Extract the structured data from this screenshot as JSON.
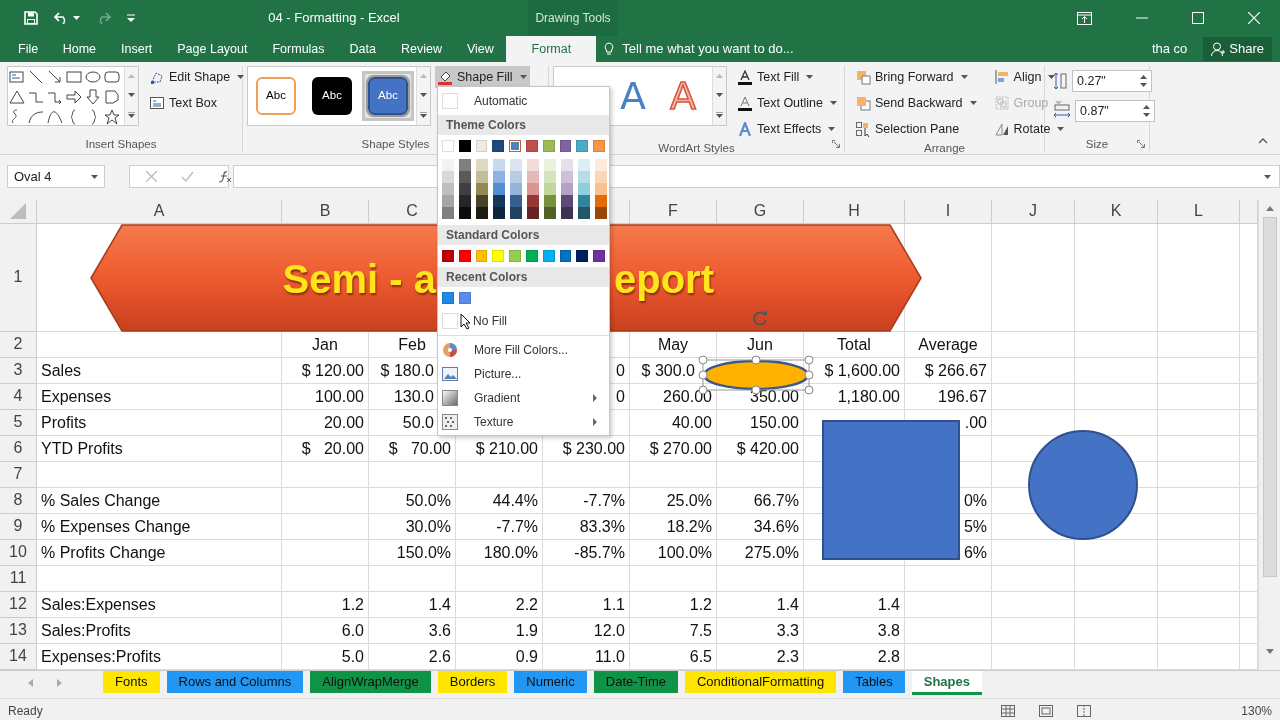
{
  "window": {
    "title": "04 - Formatting - Excel",
    "context_group": "Drawing Tools"
  },
  "ribbon_tabs": [
    {
      "label": "File",
      "selected": false
    },
    {
      "label": "Home",
      "selected": false
    },
    {
      "label": "Insert",
      "selected": false
    },
    {
      "label": "Page Layout",
      "selected": false
    },
    {
      "label": "Formulas",
      "selected": false
    },
    {
      "label": "Data",
      "selected": false
    },
    {
      "label": "Review",
      "selected": false
    },
    {
      "label": "View",
      "selected": false
    },
    {
      "label": "Format",
      "selected": true
    }
  ],
  "tell_me": "Tell me what you want to do...",
  "user": "tha co",
  "share": "Share",
  "ribbon": {
    "groups": [
      {
        "label": "Insert Shapes",
        "kind": "insert_shapes",
        "commands": [
          {
            "label": "Edit Shape",
            "kind": "edit_shape",
            "dropdown": true
          },
          {
            "label": "Text Box",
            "kind": "text_box"
          }
        ]
      },
      {
        "label": "Shape Styles",
        "kind": "shape_styles",
        "styles": [
          {
            "text": "Abc",
            "kind": "outline",
            "selected": false
          },
          {
            "text": "Abc",
            "kind": "dark",
            "selected": false
          },
          {
            "text": "Abc",
            "kind": "blue",
            "selected": true
          }
        ],
        "commands": [
          {
            "label": "Shape Fill",
            "kind": "shape_fill",
            "dropdown": true,
            "open": true
          }
        ]
      },
      {
        "label": "WordArt Styles",
        "kind": "wordart",
        "launcher": true,
        "styles": [
          {
            "text": "A",
            "kind": "fill"
          },
          {
            "text": "A",
            "kind": "outline"
          }
        ],
        "commands": [
          {
            "label": "Text Fill",
            "kind": "text_fill",
            "dropdown": true
          },
          {
            "label": "Text Outline",
            "kind": "text_outline",
            "dropdown": true
          },
          {
            "label": "Text Effects",
            "kind": "text_effects",
            "dropdown": true
          }
        ]
      },
      {
        "label": "Arrange",
        "kind": "arrange",
        "commands": [
          {
            "label": "Bring Forward",
            "kind": "bring_forward",
            "dropdown": true,
            "disabled": false
          },
          {
            "label": "Send Backward",
            "kind": "send_backward",
            "dropdown": true,
            "disabled": false
          },
          {
            "label": "Selection Pane",
            "kind": "selection_pane",
            "disabled": false
          },
          {
            "label": "Align",
            "kind": "align",
            "dropdown": true,
            "disabled": false
          },
          {
            "label": "Group",
            "kind": "group",
            "dropdown": true,
            "disabled": true
          },
          {
            "label": "Rotate",
            "kind": "rotate",
            "dropdown": true,
            "disabled": false
          }
        ]
      },
      {
        "label": "Size",
        "kind": "size",
        "launcher": true,
        "fields": [
          {
            "value": "0.27\"",
            "kind": "height"
          },
          {
            "value": "0.87\"",
            "kind": "width"
          }
        ]
      }
    ]
  },
  "fill_menu": {
    "automatic": "Automatic",
    "theme_heading": "Theme Colors",
    "theme_colors": [
      {
        "color": "#ffffff",
        "selected": false
      },
      {
        "color": "#000000",
        "selected": false
      },
      {
        "color": "#eeece1",
        "selected": false
      },
      {
        "color": "#1f497d",
        "selected": false
      },
      {
        "color": "#4f81bd",
        "selected": true
      },
      {
        "color": "#c0504d",
        "selected": false
      },
      {
        "color": "#9bbb59",
        "selected": false
      },
      {
        "color": "#8064a2",
        "selected": false
      },
      {
        "color": "#4bacc6",
        "selected": false
      },
      {
        "color": "#f79646",
        "selected": false
      }
    ],
    "theme_shades": [
      {
        "swatches": [
          {
            "color": "#f2f2f2"
          },
          {
            "color": "#d8d8d8"
          },
          {
            "color": "#bfbfbf"
          },
          {
            "color": "#a5a5a5"
          },
          {
            "color": "#7f7f7f"
          }
        ]
      },
      {
        "swatches": [
          {
            "color": "#7f7f7f"
          },
          {
            "color": "#595959"
          },
          {
            "color": "#3f3f3f"
          },
          {
            "color": "#262626"
          },
          {
            "color": "#0c0c0c"
          }
        ]
      },
      {
        "swatches": [
          {
            "color": "#ddd9c3"
          },
          {
            "color": "#c4bd97"
          },
          {
            "color": "#938953"
          },
          {
            "color": "#494429"
          },
          {
            "color": "#1d1b10"
          }
        ]
      },
      {
        "swatches": [
          {
            "color": "#c6d9f0"
          },
          {
            "color": "#8db3e2"
          },
          {
            "color": "#548dd4"
          },
          {
            "color": "#17365d"
          },
          {
            "color": "#0f243e"
          }
        ]
      },
      {
        "swatches": [
          {
            "color": "#dbe5f1"
          },
          {
            "color": "#b8cce4"
          },
          {
            "color": "#95b3d7"
          },
          {
            "color": "#366092"
          },
          {
            "color": "#244061"
          }
        ]
      },
      {
        "swatches": [
          {
            "color": "#f2dcdb"
          },
          {
            "color": "#e5b9b7"
          },
          {
            "color": "#d99694"
          },
          {
            "color": "#953734"
          },
          {
            "color": "#632423"
          }
        ]
      },
      {
        "swatches": [
          {
            "color": "#ebf1dd"
          },
          {
            "color": "#d7e3bc"
          },
          {
            "color": "#c3d69b"
          },
          {
            "color": "#76923c"
          },
          {
            "color": "#4f6128"
          }
        ]
      },
      {
        "swatches": [
          {
            "color": "#e5e0ec"
          },
          {
            "color": "#ccc1d9"
          },
          {
            "color": "#b2a2c7"
          },
          {
            "color": "#5f497a"
          },
          {
            "color": "#3f3151"
          }
        ]
      },
      {
        "swatches": [
          {
            "color": "#dbeef3"
          },
          {
            "color": "#b7dde8"
          },
          {
            "color": "#92cddc"
          },
          {
            "color": "#31859b"
          },
          {
            "color": "#205867"
          }
        ]
      },
      {
        "swatches": [
          {
            "color": "#fdeada"
          },
          {
            "color": "#fbd5b5"
          },
          {
            "color": "#fac08f"
          },
          {
            "color": "#e36c09"
          },
          {
            "color": "#974806"
          }
        ]
      }
    ],
    "standard_heading": "Standard Colors",
    "standard_colors": [
      {
        "color": "#c00000"
      },
      {
        "color": "#ff0000"
      },
      {
        "color": "#ffc000"
      },
      {
        "color": "#ffff00"
      },
      {
        "color": "#92d050"
      },
      {
        "color": "#00b050"
      },
      {
        "color": "#00b0f0"
      },
      {
        "color": "#0070c0"
      },
      {
        "color": "#002060"
      },
      {
        "color": "#7030a0"
      }
    ],
    "recent_heading": "Recent Colors",
    "recent_colors": [
      {
        "color": "#1e88e5"
      },
      {
        "color": "#5a8cf0"
      }
    ],
    "no_fill": "No Fill",
    "commands": [
      {
        "label": "More Fill Colors...",
        "kind": "palette"
      },
      {
        "label": "Picture...",
        "kind": "picture"
      },
      {
        "label": "Gradient",
        "kind": "gradient",
        "submenu": true
      },
      {
        "label": "Texture",
        "kind": "texture",
        "submenu": true
      }
    ]
  },
  "name_box": "Oval 4",
  "sheet": {
    "columns": [
      "A",
      "B",
      "C",
      null,
      null,
      "F",
      "G",
      "H",
      "I",
      "J",
      "K",
      "L"
    ],
    "banner": {
      "title_parts": [
        "Semi - a",
        "eport"
      ]
    },
    "rows": [
      {
        "number": "1",
        "kind": "data"
      },
      {
        "number": "2",
        "kind": "header",
        "cells": [
          null,
          "Jan",
          "Feb",
          null,
          null,
          "May",
          "Jun",
          "Total",
          "Average"
        ]
      },
      {
        "number": "3",
        "kind": "data",
        "cells": [
          "Sales",
          "$ 120.00",
          {
            "text": "$ 180.0",
            "cut": true
          },
          null,
          "0",
          {
            "text": "$ 300.0",
            "cut": true
          },
          null,
          "$ 1,600.00",
          "$ 266.67"
        ]
      },
      {
        "number": "4",
        "kind": "data",
        "cells": [
          "Expenses",
          "100.00",
          {
            "text": "130.0",
            "cut": true
          },
          null,
          "0",
          "260.00",
          "350.00",
          "1,180.00",
          "196.67"
        ]
      },
      {
        "number": "5",
        "kind": "data",
        "cells": [
          "Profits",
          "20.00",
          {
            "text": "50.0",
            "cut": true
          },
          null,
          null,
          "40.00",
          "150.00",
          null,
          ".00"
        ]
      },
      {
        "number": "6",
        "kind": "data",
        "cells": [
          "YTD Profits",
          "$   20.00",
          "$   70.00",
          "$ 210.00",
          "$ 230.00",
          "$ 270.00",
          "$ 420.00"
        ]
      },
      {
        "number": "7",
        "kind": "data"
      },
      {
        "number": "8",
        "kind": "data",
        "cells": [
          "% Sales Change",
          null,
          "50.0%",
          "44.4%",
          "-7.7%",
          "25.0%",
          "66.7%",
          null,
          "0%"
        ]
      },
      {
        "number": "9",
        "kind": "data",
        "cells": [
          "% Expenses Change",
          null,
          "30.0%",
          "-7.7%",
          "83.3%",
          "18.2%",
          "34.6%",
          null,
          "5%"
        ]
      },
      {
        "number": "10",
        "kind": "data",
        "cells": [
          "% Profits Change",
          null,
          "150.0%",
          "180.0%",
          "-85.7%",
          "100.0%",
          "275.0%",
          null,
          "6%"
        ]
      },
      {
        "number": "11",
        "kind": "data"
      },
      {
        "number": "12",
        "kind": "data",
        "cells": [
          "Sales:Expenses",
          "1.2",
          "1.4",
          "2.2",
          "1.1",
          "1.2",
          "1.4",
          "1.4"
        ]
      },
      {
        "number": "13",
        "kind": "data",
        "cells": [
          "Sales:Profits",
          "6.0",
          "3.6",
          "1.9",
          "12.0",
          "7.5",
          "3.3",
          "3.8"
        ]
      },
      {
        "number": "14",
        "kind": "data",
        "cells": [
          "Expenses:Profits",
          "5.0",
          "2.6",
          "0.9",
          "11.0",
          "6.5",
          "2.3",
          "2.8"
        ]
      }
    ]
  },
  "sheet_tabs": [
    {
      "label": "Fonts",
      "color": "#ffe600",
      "selected": false
    },
    {
      "label": "Rows and Columns",
      "color": "#2196f3",
      "selected": false
    },
    {
      "label": "AlignWrapMerge",
      "color": "#0f9447",
      "selected": false
    },
    {
      "label": "Borders",
      "color": "#ffe600",
      "selected": false
    },
    {
      "label": "Numeric",
      "color": "#2196f3",
      "selected": false
    },
    {
      "label": "Date-Time",
      "color": "#0f9447",
      "selected": false
    },
    {
      "label": "ConditionalFormatting",
      "color": "#ffe600",
      "selected": false
    },
    {
      "label": "Tables",
      "color": "#2196f3",
      "selected": false
    },
    {
      "label": "Shapes",
      "color": "#0f9447",
      "selected": true
    }
  ],
  "status_bar": {
    "text": "Ready",
    "zoom": "130%"
  }
}
